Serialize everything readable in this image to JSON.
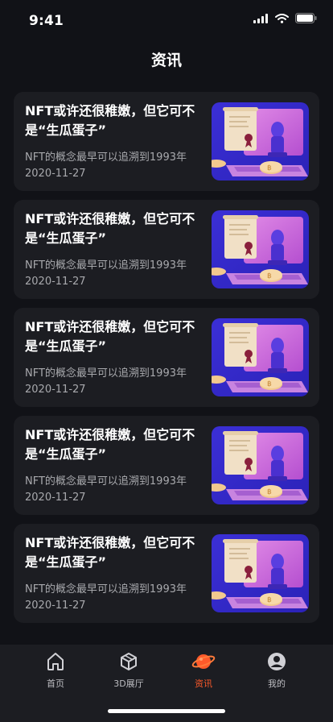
{
  "status_bar": {
    "time": "9:41"
  },
  "header": {
    "title": "资讯"
  },
  "articles": [
    {
      "title": "NFT或许还很稚嫩，但它可不是“生瓜蛋子”",
      "subtitle": "NFT的概念最早可以追溯到1993年",
      "date": "2020-11-27"
    },
    {
      "title": "NFT或许还很稚嫩，但它可不是“生瓜蛋子”",
      "subtitle": "NFT的概念最早可以追溯到1993年",
      "date": "2020-11-27"
    },
    {
      "title": "NFT或许还很稚嫩，但它可不是“生瓜蛋子”",
      "subtitle": "NFT的概念最早可以追溯到1993年",
      "date": "2020-11-27"
    },
    {
      "title": "NFT或许还很稚嫩，但它可不是“生瓜蛋子”",
      "subtitle": "NFT的概念最早可以追溯到1993年",
      "date": "2020-11-27"
    },
    {
      "title": "NFT或许还很稚嫩，但它可不是“生瓜蛋子”",
      "subtitle": "NFT的概念最早可以追溯到1993年",
      "date": "2020-11-27"
    }
  ],
  "bottom_nav": [
    {
      "label": "首页",
      "icon": "home-icon",
      "active": false
    },
    {
      "label": "3D展厅",
      "icon": "cube-icon",
      "active": false
    },
    {
      "label": "资讯",
      "icon": "planet-icon",
      "active": true
    },
    {
      "label": "我的",
      "icon": "user-icon",
      "active": false
    }
  ],
  "colors": {
    "background": "#111217",
    "card": "#1c1d22",
    "accent": "#ff5a2a",
    "thumb_bg": "#3a2fd9"
  }
}
